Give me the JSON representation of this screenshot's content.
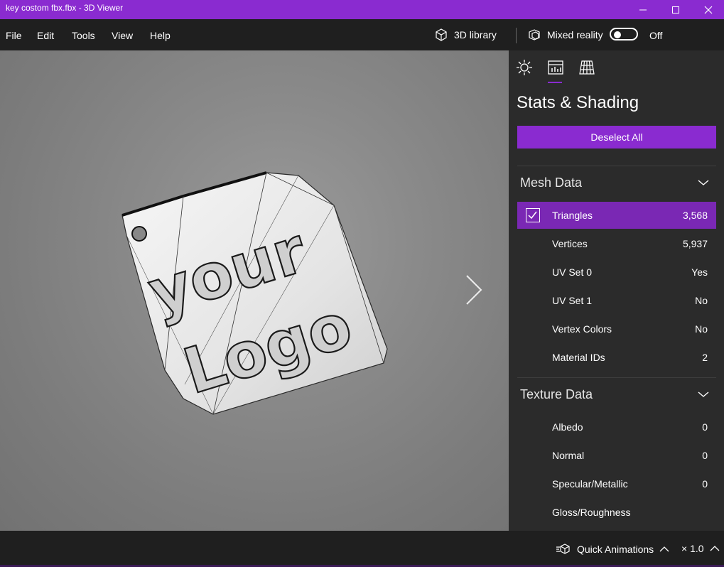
{
  "window": {
    "title": "key costom fbx.fbx - 3D Viewer",
    "accent_color": "#8a2bd0",
    "controls": [
      "minimize-icon",
      "maximize-icon",
      "close-icon"
    ]
  },
  "menu": {
    "items": [
      "File",
      "Edit",
      "Tools",
      "View",
      "Help"
    ]
  },
  "toolbar": {
    "library_label": "3D library",
    "mixed_reality_label": "Mixed reality",
    "mixed_reality_state": "Off"
  },
  "viewport": {
    "model_text_line1": "your",
    "model_text_line2": "Logo",
    "next_icon": "chevron-right-icon"
  },
  "panel": {
    "tabs": [
      "sun-icon",
      "stats-icon",
      "grid-icon"
    ],
    "active_tab": "stats-icon",
    "title": "Stats & Shading",
    "deselect_label": "Deselect All",
    "mesh_section": {
      "title": "Mesh Data",
      "rows": [
        {
          "label": "Triangles",
          "value": "3,568",
          "checked": true
        },
        {
          "label": "Vertices",
          "value": "5,937"
        },
        {
          "label": "UV Set 0",
          "value": "Yes"
        },
        {
          "label": "UV Set 1",
          "value": "No"
        },
        {
          "label": "Vertex Colors",
          "value": "No"
        },
        {
          "label": "Material IDs",
          "value": "2"
        }
      ]
    },
    "texture_section": {
      "title": "Texture Data",
      "rows": [
        {
          "label": "Albedo",
          "value": "0"
        },
        {
          "label": "Normal",
          "value": "0"
        },
        {
          "label": "Specular/Metallic",
          "value": "0"
        },
        {
          "label": "Gloss/Roughness",
          "value": ""
        }
      ]
    }
  },
  "status": {
    "animations_label": "Quick Animations",
    "speed_label": "× 1.0"
  }
}
